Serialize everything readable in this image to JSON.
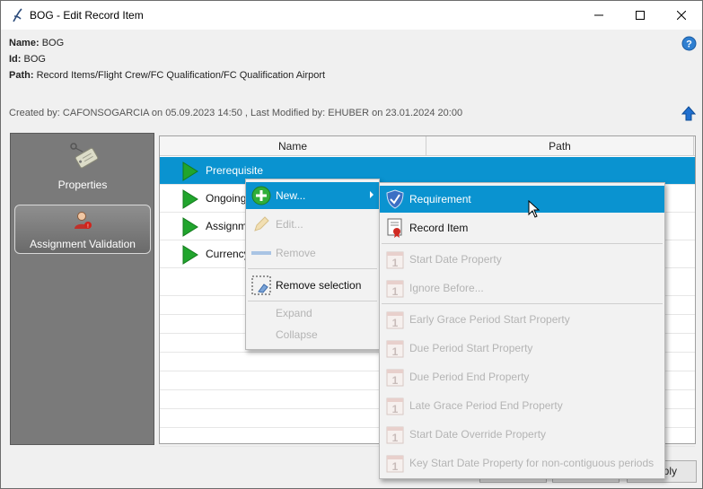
{
  "window": {
    "title": "BOG - Edit Record Item"
  },
  "info": {
    "name_label": "Name:",
    "name_value": "BOG",
    "id_label": "Id:",
    "id_value": "BOG",
    "path_label": "Path:",
    "path_value": "Record Items/Flight Crew/FC Qualification/FC Qualification Airport",
    "created_text": "Created by: CAFONSOGARCIA on 05.09.2023 14:50 ,  Last Modified by: EHUBER on 23.01.2024 20:00"
  },
  "sidebar": {
    "items": [
      {
        "label": "Properties",
        "icon": "tag-icon"
      },
      {
        "label": "Assignment Validation",
        "icon": "user-warning-icon"
      }
    ]
  },
  "table": {
    "columns": [
      "Name",
      "Path"
    ],
    "rows": [
      {
        "name": "Prerequisite",
        "path": ""
      },
      {
        "name": "Ongoing",
        "path": ""
      },
      {
        "name": "Assignm",
        "path": ""
      },
      {
        "name": "Currency",
        "path": ""
      }
    ]
  },
  "context_menu": {
    "items": [
      {
        "label": "New...",
        "enabled": true,
        "icon": "plus-circle-icon"
      },
      {
        "label": "Edit...",
        "enabled": false,
        "icon": "pencil-icon"
      },
      {
        "label": "Remove",
        "enabled": false,
        "icon": "minus-icon"
      },
      {
        "label": "Remove selection",
        "enabled": true,
        "icon": "selection-eraser-icon"
      },
      {
        "label": "Expand",
        "enabled": false
      },
      {
        "label": "Collapse",
        "enabled": false
      }
    ]
  },
  "submenu": {
    "items": [
      {
        "label": "Requirement",
        "enabled": true,
        "icon": "shield-check-icon"
      },
      {
        "label": "Record Item",
        "enabled": true,
        "icon": "certificate-icon"
      },
      {
        "label": "Start Date Property",
        "enabled": false,
        "icon": "calendar-icon"
      },
      {
        "label": "Ignore Before...",
        "enabled": false,
        "icon": "calendar-icon"
      },
      {
        "label": "Early Grace Period Start Property",
        "enabled": false,
        "icon": "calendar-icon"
      },
      {
        "label": "Due Period Start Property",
        "enabled": false,
        "icon": "calendar-icon"
      },
      {
        "label": "Due Period End Property",
        "enabled": false,
        "icon": "calendar-icon"
      },
      {
        "label": "Late Grace Period End Property",
        "enabled": false,
        "icon": "calendar-icon"
      },
      {
        "label": "Start Date Override Property",
        "enabled": false,
        "icon": "calendar-icon"
      },
      {
        "label": "Key Start Date Property for non-contiguous periods",
        "enabled": false,
        "icon": "calendar-icon"
      }
    ],
    "calendar_digit": "1"
  },
  "buttons": {
    "apply_visible_text": "ply"
  },
  "colors": {
    "selection": "#0a93d0",
    "sidebar": "#7a7a7a"
  }
}
